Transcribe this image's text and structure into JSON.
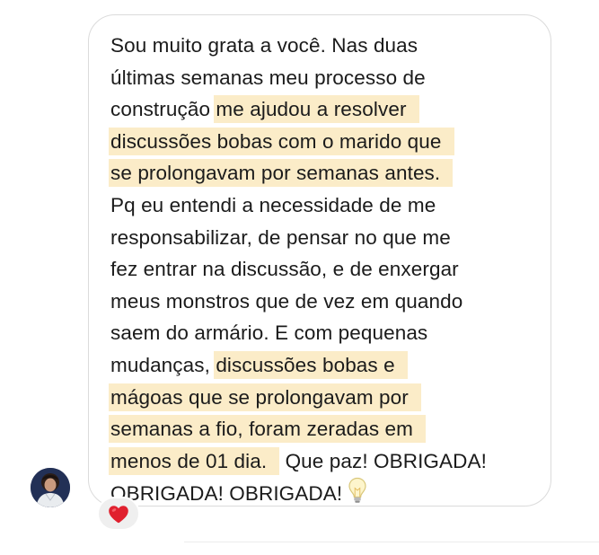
{
  "message": {
    "lines": [
      {
        "text": "Sou muito grata a você. Nas duas"
      },
      {
        "text": "últimas semanas meu processo de"
      },
      {
        "text": "construção ",
        "highlight": "me ajudou a resolver"
      },
      {
        "highlight": "discussões bobas com o marido que"
      },
      {
        "highlight": "se prolongavam por semanas antes."
      },
      {
        "text": "Pq eu entendi a necessidade de me"
      },
      {
        "text": "responsabilizar, de pensar no que me"
      },
      {
        "text": "fez entrar na discussão, e de enxergar"
      },
      {
        "text": "meus monstros que de vez em quando"
      },
      {
        "text": "saem do armário. E com pequenas"
      },
      {
        "text": "mudanças, ",
        "highlight": "discussões bobas e"
      },
      {
        "highlight": "mágoas que se prolongavam por"
      },
      {
        "highlight": "semanas a fio, foram zeradas em"
      },
      {
        "highlight": "menos de 01 dia.",
        "after": " Que paz! OBRIGADA!"
      },
      {
        "text": "OBRIGADA! OBRIGADA!"
      }
    ],
    "end_emoji": "lightbulb-icon"
  },
  "reaction": {
    "emoji": "red-heart-icon",
    "color": "#e0202e"
  },
  "colors": {
    "highlight": "#fbecc8",
    "bubble_border": "#dbdbdb",
    "text": "#1b1b1b",
    "reaction_bg": "#efefef"
  }
}
